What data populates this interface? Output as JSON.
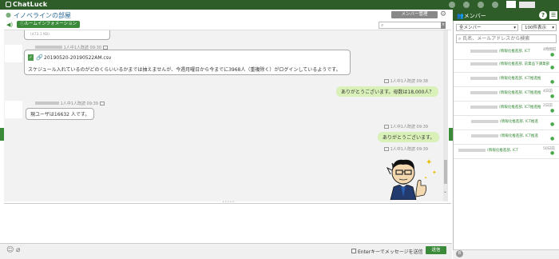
{
  "app": {
    "title": "ChatLuck"
  },
  "room": {
    "title": "イノベラインの部屋",
    "info_button": "ルームインフォメーション",
    "member_manage_button": "メンバー管理"
  },
  "messages": {
    "top_snippet": "(473.1 KB)",
    "meta1": "1人中1人既読 09:30",
    "file_name": "20190520-20190522AM.csv",
    "msg1": "スケジュール入れているのがどのくらいいるかまでは抽えませんが、今週月曜日から今までに3968人（重複除く）がログインしているようです。",
    "meta2": "1人中1人既読 09:38",
    "reply1": "ありがとうございます。母数は18,000人？",
    "meta3": "1人中1人既読 09:39",
    "msg3": "現ユーザは16632 人です。",
    "meta4": "1人中1人既読 09:39",
    "reply2": "ありがとうございます。",
    "meta5": "1人中1人既読 09:39"
  },
  "input": {
    "enter_label": "Enterキーでメッセージを送信",
    "send_button": "送信"
  },
  "right_panel": {
    "title": "メンバー",
    "select_filter": "全メンバー",
    "select_count": "100件表示",
    "search_placeholder": "氏名、メールアドレスから検索",
    "members": [
      {
        "name": "(情報化推進部, ICT",
        "time": "4時間前"
      },
      {
        "name": "(情報化推進部, 前業品下講業部",
        "time": ""
      },
      {
        "name": "(情報化推進部, ICT推進推",
        "time": ""
      },
      {
        "name": "(情報化推進部, ICT推進推",
        "time": "4日前"
      },
      {
        "name": "(情報化推進部, ICT推進推",
        "time": "2日前"
      },
      {
        "name": "(情報化推進部, ICT推進",
        "time": ""
      },
      {
        "name": "(情報化推進部, ICT推進",
        "time": ""
      },
      {
        "name": "(情報化推進部, ICT",
        "time": "50日前"
      }
    ]
  },
  "colors": {
    "top_bar": "#2e5d2a",
    "accent_green": "#3a8a3a",
    "reply_bubble": "#d9f0b8",
    "room_title": "#2a6a99"
  }
}
